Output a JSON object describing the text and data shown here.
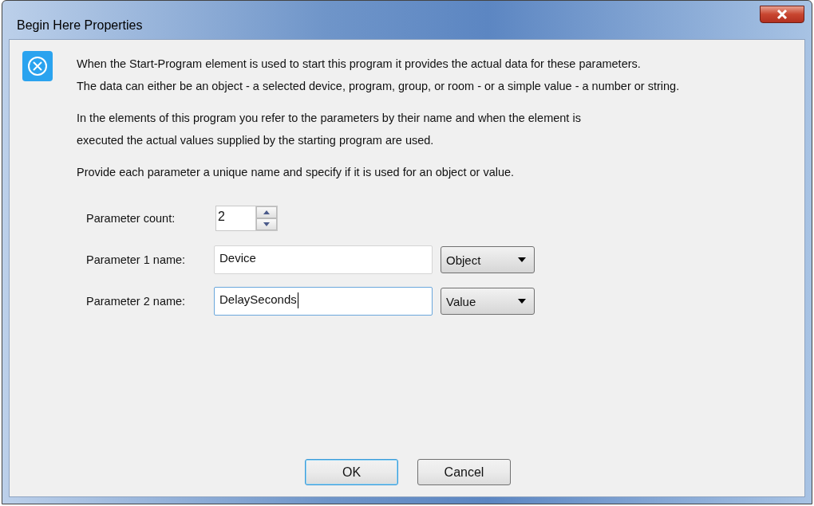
{
  "window": {
    "title": "Begin Here Properties"
  },
  "paragraphs": [
    {
      "lines": [
        "When the Start-Program element is used to start this program it provides the actual data for these parameters.",
        "The data can either be an object - a selected device, program, group, or room - or a simple value - a number or string."
      ]
    },
    {
      "lines": [
        "In the elements of this program you refer to the parameters by their name and when the element is",
        "executed the actual values supplied by the starting program are used."
      ]
    },
    {
      "lines": [
        "Provide each parameter a unique name and specify if it is used for an object or value."
      ]
    }
  ],
  "parameter_count": {
    "label": "Parameter count:",
    "value": "2"
  },
  "parameters": [
    {
      "label": "Parameter 1 name:",
      "value": "Device",
      "focused": false,
      "type": "Object"
    },
    {
      "label": "Parameter 2 name:",
      "value": "DelaySeconds",
      "focused": true,
      "type": "Value"
    }
  ],
  "buttons": [
    {
      "label": "OK",
      "default": true
    },
    {
      "label": "Cancel",
      "default": false
    }
  ]
}
